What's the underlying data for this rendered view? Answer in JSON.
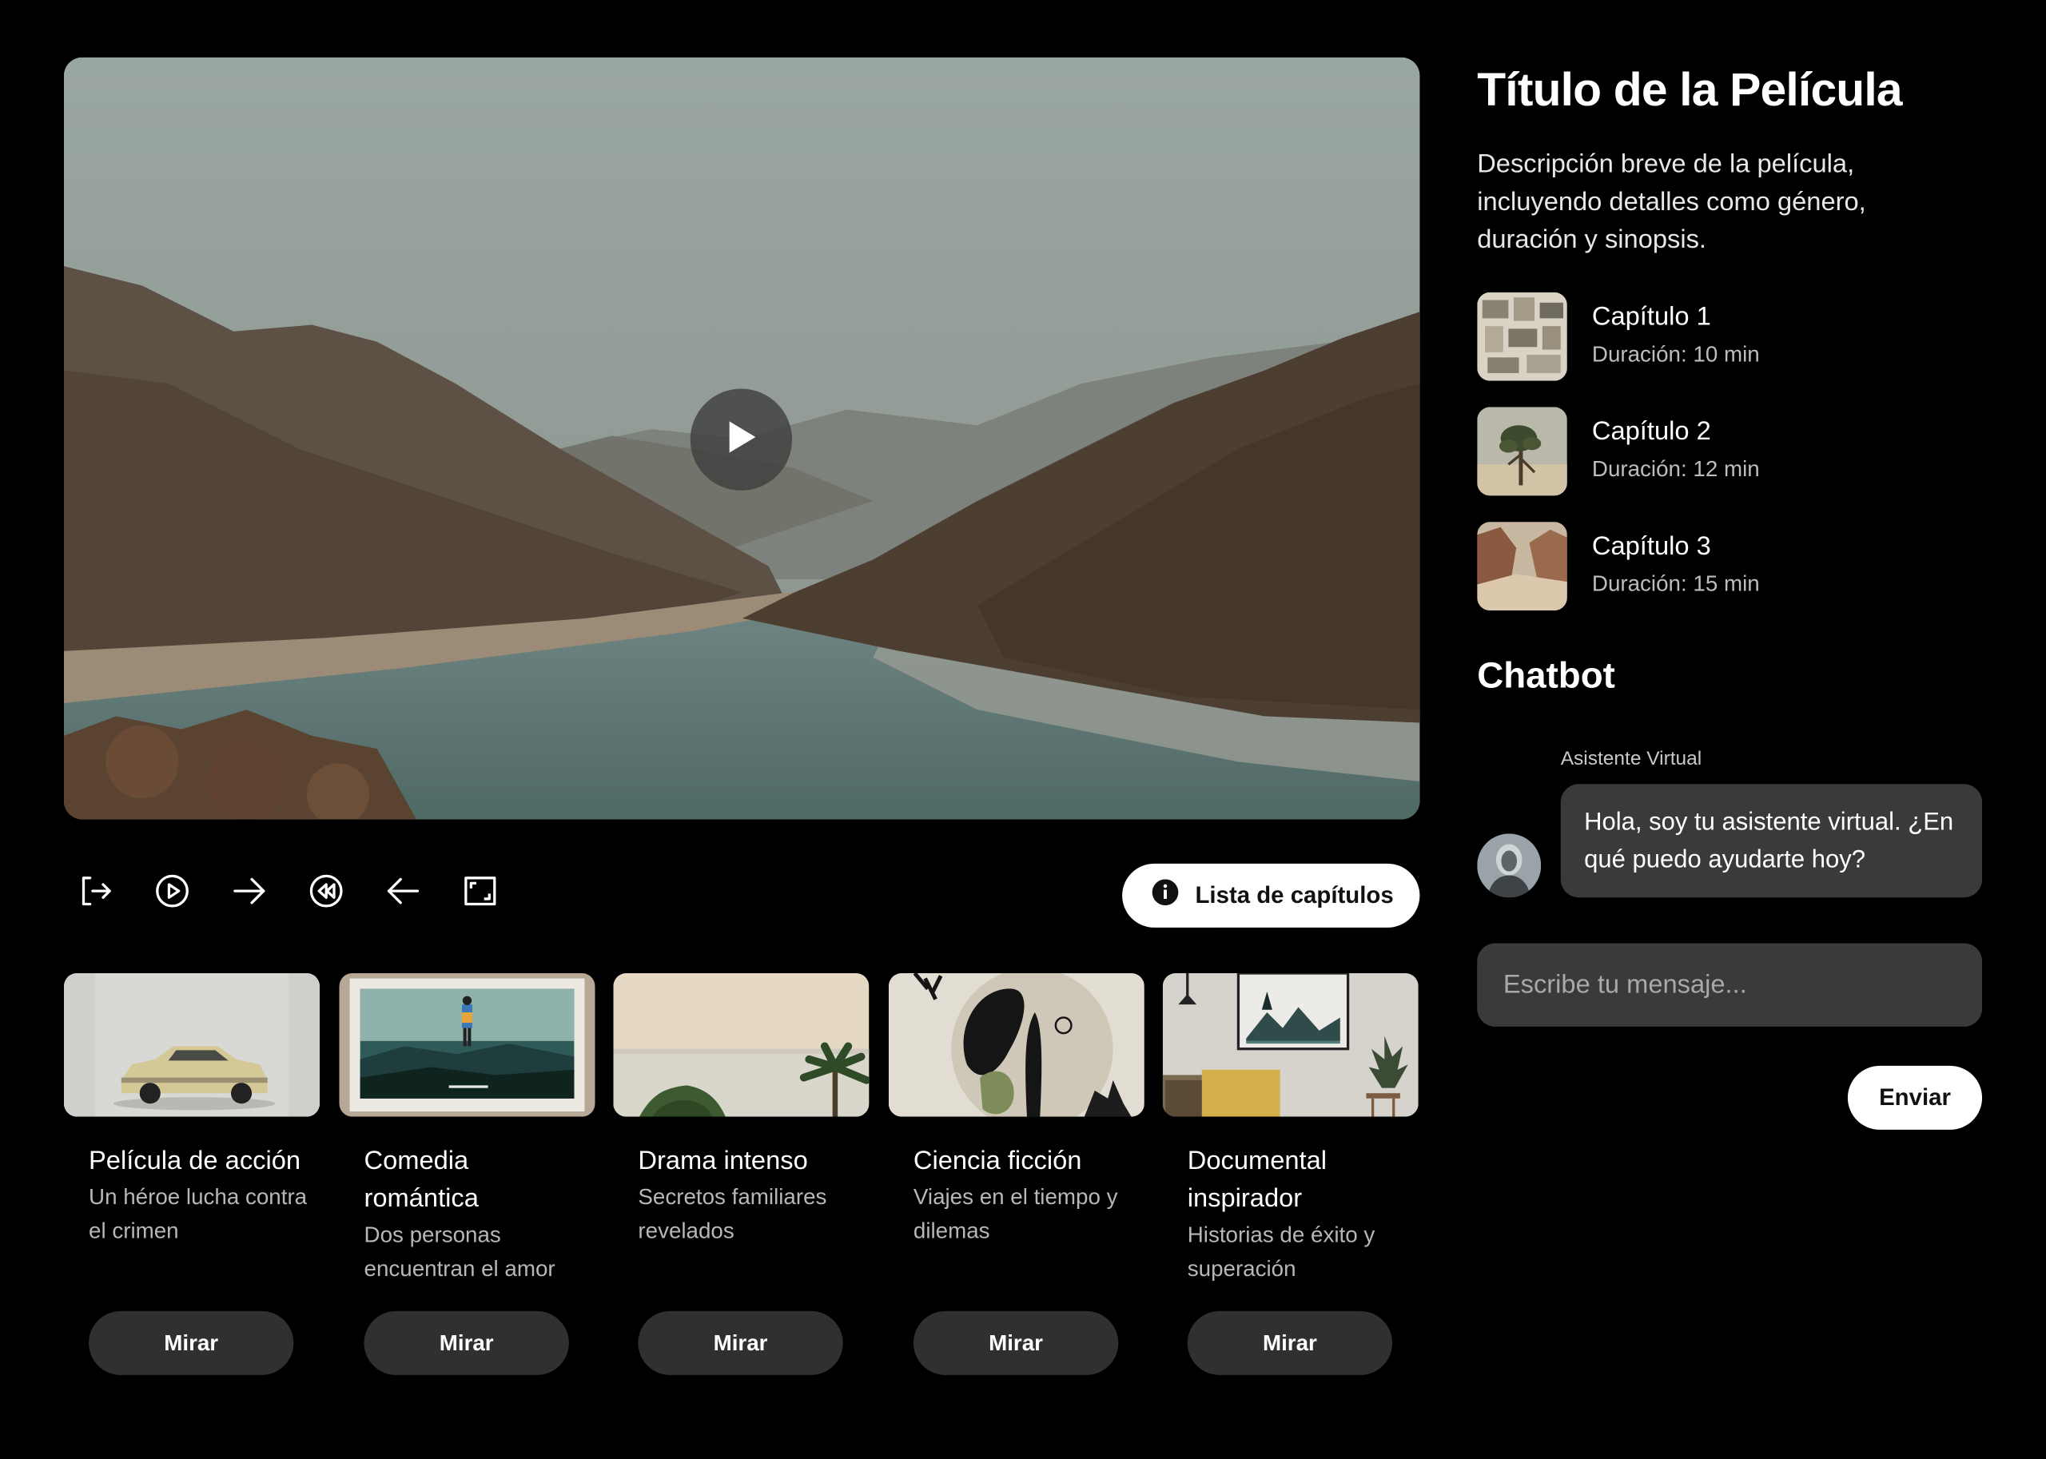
{
  "player": {
    "play_icon": "play-icon",
    "controls": [
      {
        "name": "exit-button",
        "icon": "exit-icon"
      },
      {
        "name": "play-control-button",
        "icon": "play-circle-icon"
      },
      {
        "name": "forward-button",
        "icon": "arrow-right-icon"
      },
      {
        "name": "rewind-button",
        "icon": "rewind-icon"
      },
      {
        "name": "back-button",
        "icon": "arrow-left-icon"
      },
      {
        "name": "fullscreen-button",
        "icon": "fullscreen-icon"
      }
    ],
    "chapters_button_label": "Lista de capítulos",
    "chapters_button_icon": "info-icon"
  },
  "movies": [
    {
      "title": "Película de acción",
      "desc": "Un héroe lucha contra el crimen",
      "button": "Mirar"
    },
    {
      "title": "Comedia romántica",
      "desc": "Dos personas encuentran el amor",
      "button": "Mirar"
    },
    {
      "title": "Drama intenso",
      "desc": "Secretos familiares revelados",
      "button": "Mirar"
    },
    {
      "title": "Ciencia ficción",
      "desc": "Viajes en el tiempo y dilemas",
      "button": "Mirar"
    },
    {
      "title": "Documental inspirador",
      "desc": "Historias de éxito y superación",
      "button": "Mirar"
    }
  ],
  "details": {
    "title": "Título de la Película",
    "description": "Descripción breve de la película, incluyendo detalles como género, duración y sinopsis."
  },
  "chapters": [
    {
      "name": "Capítulo 1",
      "duration": "Duración: 10 min"
    },
    {
      "name": "Capítulo 2",
      "duration": "Duración: 12 min"
    },
    {
      "name": "Capítulo 3",
      "duration": "Duración: 15 min"
    }
  ],
  "chat": {
    "title": "Chatbot",
    "sender": "Asistente Virtual",
    "message": "Hola, soy tu asistente virtual. ¿En qué puedo ayudarte hoy?",
    "input_placeholder": "Escribe tu mensaje...",
    "send_label": "Enviar"
  },
  "colors": {
    "background": "#000000",
    "surface": "#3a3a3a",
    "button_dark": "#303030",
    "button_light": "#ffffff"
  }
}
